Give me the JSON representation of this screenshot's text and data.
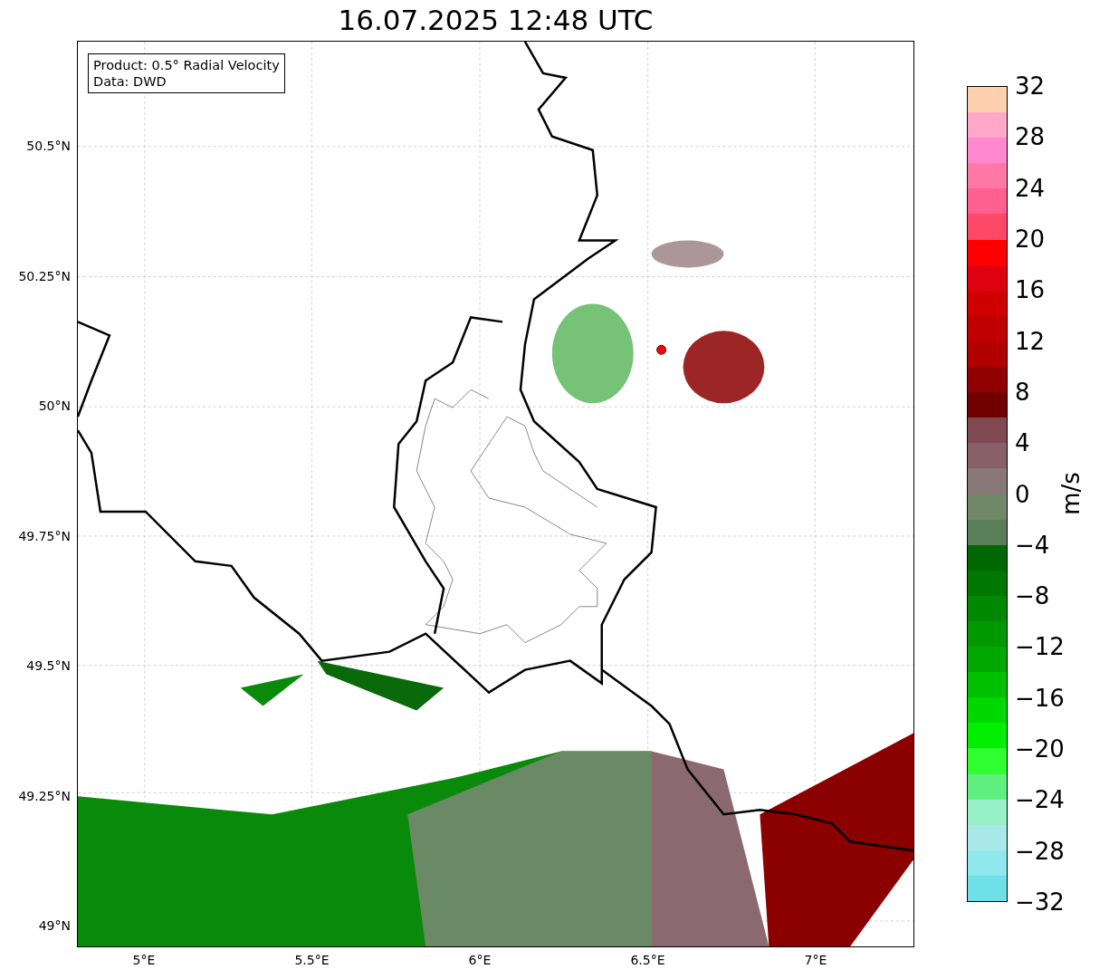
{
  "title": "16.07.2025 12:48 UTC",
  "info_box": [
    "Product: 0.5° Radial Velocity",
    "Data: DWD"
  ],
  "y_ticks": [
    "50.5°N",
    "50.25°N",
    "50°N",
    "49.75°N",
    "49.5°N",
    "49.25°N",
    "49°N"
  ],
  "x_ticks": [
    "5°E",
    "5.5°E",
    "6°E",
    "6.5°E",
    "7°E"
  ],
  "colorbar": {
    "unit": "m/s",
    "ticks": [
      "32",
      "28",
      "24",
      "20",
      "16",
      "12",
      "8",
      "4",
      "0",
      "−4",
      "−8",
      "−12",
      "−16",
      "−20",
      "−24",
      "−28",
      "−32"
    ],
    "bands": [
      {
        "color": "#ffd0b0"
      },
      {
        "color": "#ffa8c8"
      },
      {
        "color": "#ff88d0"
      },
      {
        "color": "#ff78a8"
      },
      {
        "color": "#ff6090"
      },
      {
        "color": "#ff4868"
      },
      {
        "color": "#ff0000"
      },
      {
        "color": "#e00010"
      },
      {
        "color": "#d00000"
      },
      {
        "color": "#c00000"
      },
      {
        "color": "#b00000"
      },
      {
        "color": "#900000"
      },
      {
        "color": "#700000"
      },
      {
        "color": "#804850"
      },
      {
        "color": "#886068"
      },
      {
        "color": "#887878"
      },
      {
        "color": "#708868"
      },
      {
        "color": "#5a7e58"
      },
      {
        "color": "#006800"
      },
      {
        "color": "#007800"
      },
      {
        "color": "#008800"
      },
      {
        "color": "#009800"
      },
      {
        "color": "#00a800"
      },
      {
        "color": "#00c000"
      },
      {
        "color": "#00d800"
      },
      {
        "color": "#00f000"
      },
      {
        "color": "#30ff30"
      },
      {
        "color": "#60f080"
      },
      {
        "color": "#98f0c8"
      },
      {
        "color": "#a8e8e8"
      },
      {
        "color": "#90e8ec"
      },
      {
        "color": "#70e0e8"
      }
    ]
  }
}
